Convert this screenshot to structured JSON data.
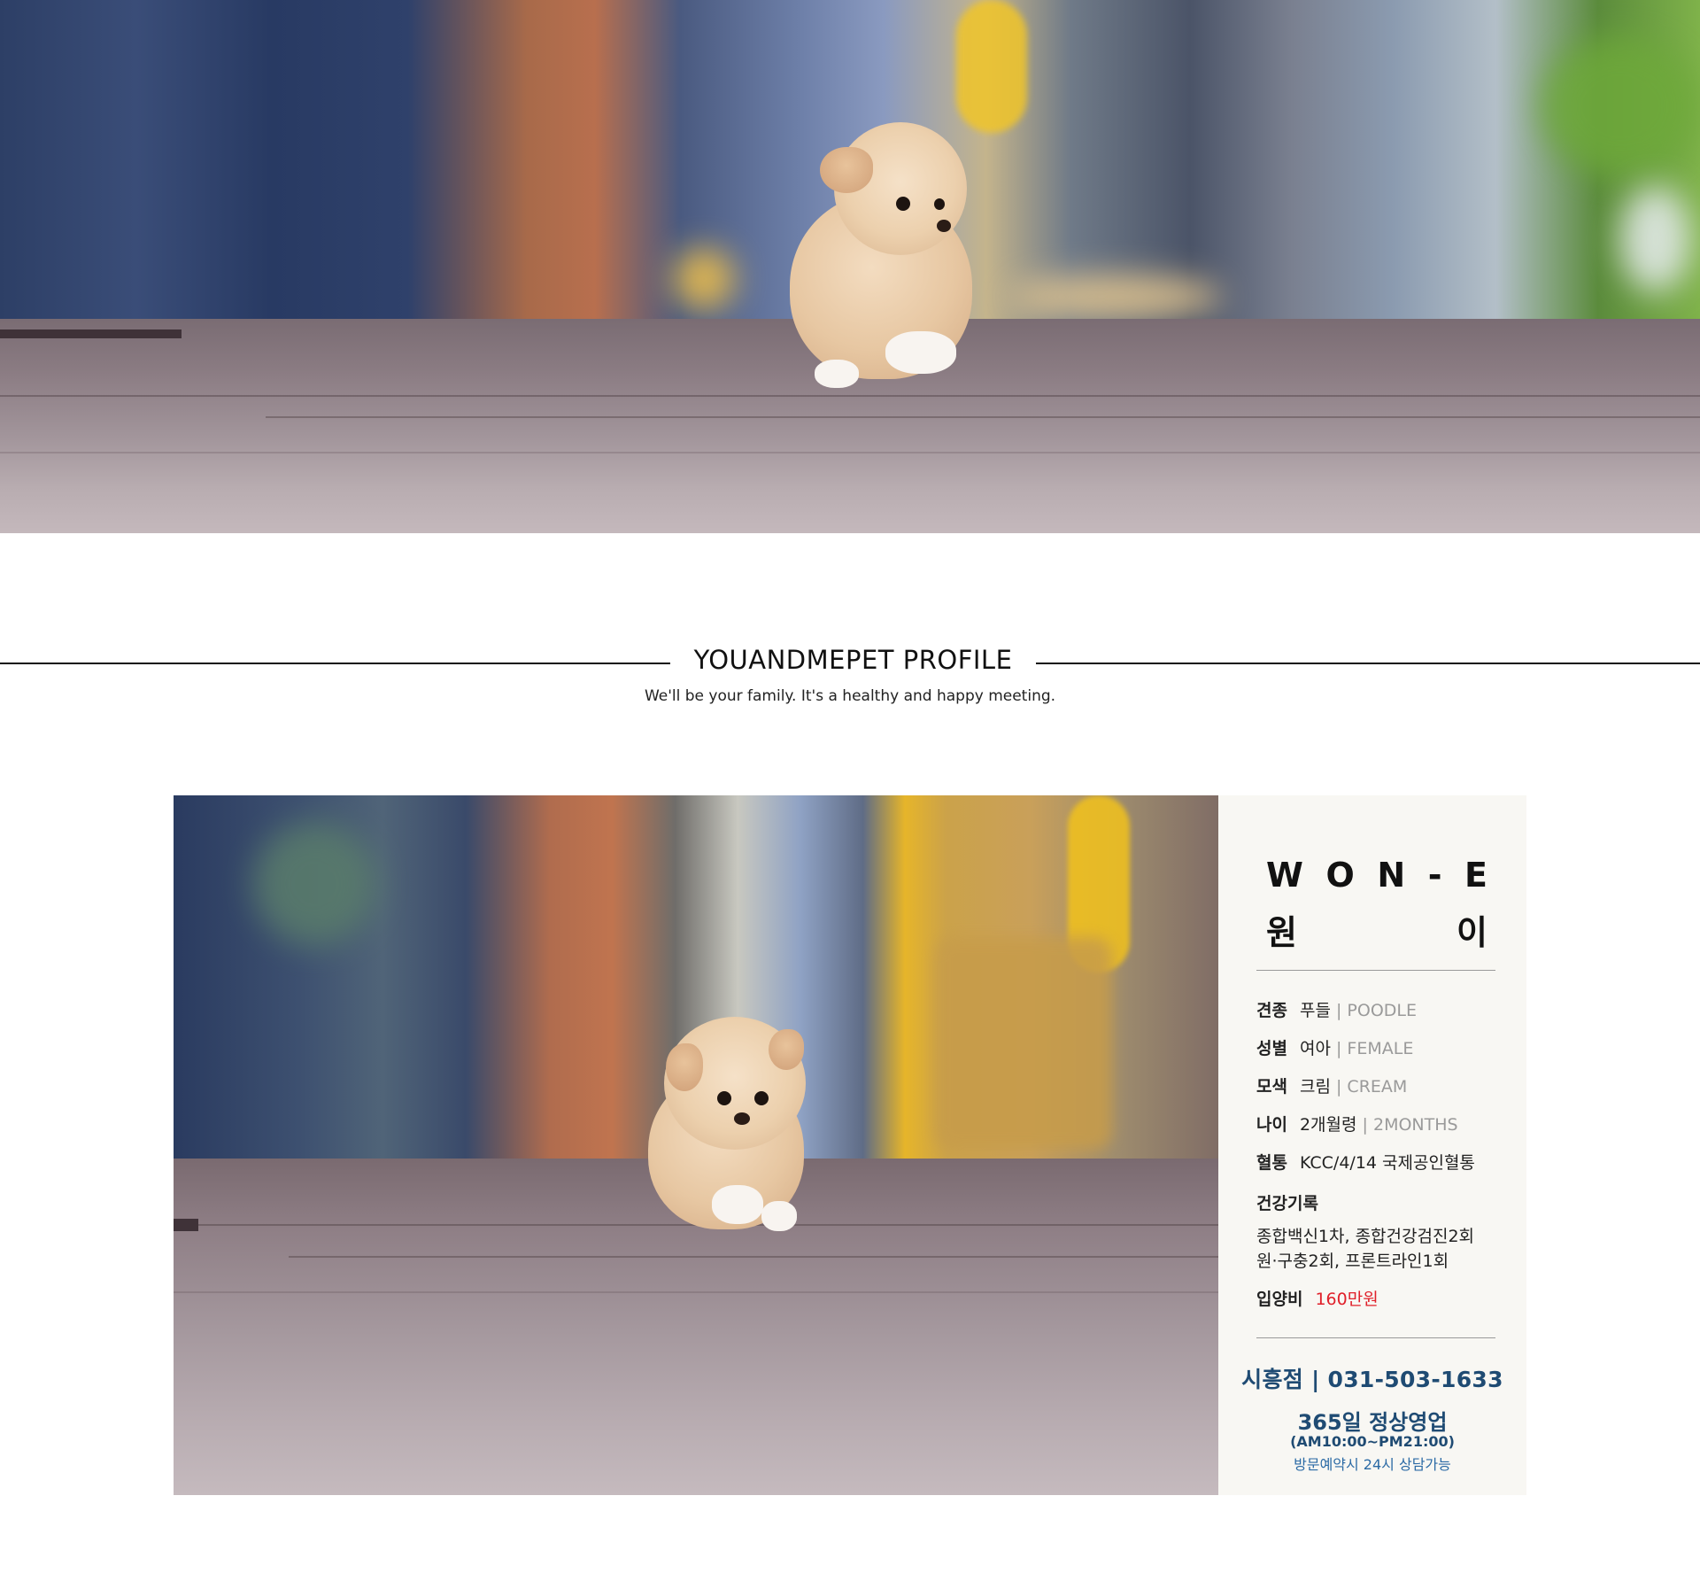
{
  "section": {
    "title": "YOUANDMEPET PROFILE",
    "subtitle": "We'll be your family. It's a healthy and happy meeting."
  },
  "profile": {
    "name_en_letters": [
      "W",
      "O",
      "N",
      "-",
      "E"
    ],
    "name_ko_letters": [
      "원",
      "이"
    ],
    "rows": [
      {
        "key": "견종",
        "value_ko": "푸들",
        "sep": " | ",
        "value_en": "POODLE"
      },
      {
        "key": "성별",
        "value_ko": "여아",
        "sep": " | ",
        "value_en": "FEMALE"
      },
      {
        "key": "모색",
        "value_ko": "크림",
        "sep": " | ",
        "value_en": "CREAM"
      },
      {
        "key": "나이",
        "value_ko": "2개월령",
        "sep": " | ",
        "value_en": "2MONTHS"
      },
      {
        "key": "혈통",
        "value_ko": "KCC/4/14 국제공인혈통",
        "sep": "",
        "value_en": ""
      }
    ],
    "health_label": "건강기록",
    "health_lines": [
      "종합백신1차, 종합건강검진2회",
      "원·구충2회, 프론트라인1회"
    ],
    "price_label": "입양비",
    "price_value": "160만원",
    "store": "시흥점 | 031-503-1633",
    "open": "365일 정상영업",
    "hours": "(AM10:00~PM21:00)",
    "visit": "방문예약시 24시 상담가능"
  },
  "colors": {
    "accent_navy": "#1f4b73",
    "price_red": "#e0202a",
    "panel_bg": "#f8f7f3"
  }
}
